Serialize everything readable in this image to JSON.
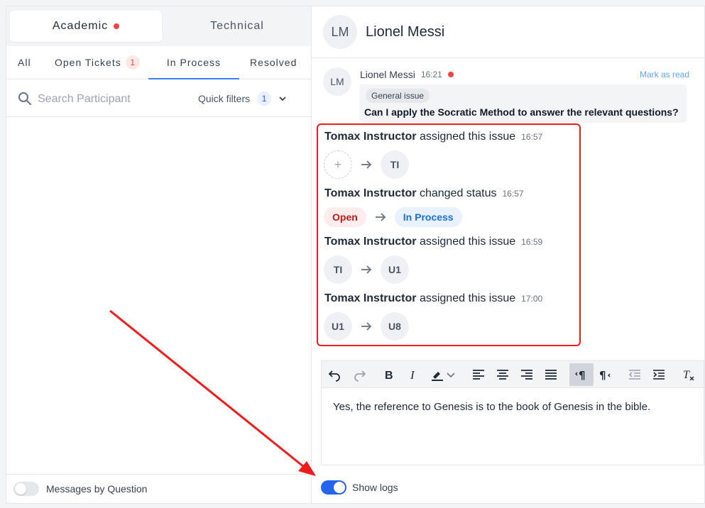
{
  "tabs": {
    "academic": "Academic",
    "technical": "Technical"
  },
  "subtabs": {
    "all": "All",
    "open_tickets": "Open Tickets",
    "open_tickets_count": "1",
    "in_process": "In Process",
    "resolved": "Resolved"
  },
  "search": {
    "placeholder": "Search Participant",
    "quick_filters": "Quick filters",
    "quick_filters_count": "1"
  },
  "left_footer": {
    "label": "Messages by Question",
    "toggle_on": false
  },
  "header": {
    "initials": "LM",
    "name": "Lionel Messi"
  },
  "message": {
    "initials": "LM",
    "sender": "Lionel Messi",
    "time": "16:21",
    "mark_read": "Mark as read",
    "tag": "General issue",
    "text": "Can I apply the Socratic Method to answer the relevant questions?"
  },
  "logs": [
    {
      "actor": "Tomax Instructor",
      "action": "assigned this issue",
      "time": "16:57",
      "from": "+",
      "to": "TI"
    },
    {
      "actor": "Tomax Instructor",
      "action": "changed status",
      "time": "16:57",
      "from": "Open",
      "to": "In Process"
    },
    {
      "actor": "Tomax Instructor",
      "action": "assigned this issue",
      "time": "16:59",
      "from": "TI",
      "to": "U1"
    },
    {
      "actor": "Tomax Instructor",
      "action": "assigned this issue",
      "time": "17:00",
      "from": "U1",
      "to": "U8"
    }
  ],
  "toolbar_icons": [
    "undo-icon",
    "redo-icon",
    "bold-icon",
    "italic-icon",
    "highlight-icon",
    "chevron-down-icon",
    "align-left-icon",
    "align-center-icon",
    "align-right-icon",
    "align-justify-icon",
    "ltr-icon",
    "rtl-icon",
    "outdent-icon",
    "indent-icon",
    "clear-format-icon"
  ],
  "editor": {
    "text": "Yes, the reference to Genesis is to the book of Genesis in the bible."
  },
  "right_footer": {
    "label": "Show logs",
    "toggle_on": true
  },
  "colors": {
    "accent": "#2563eb",
    "highlight_box": "#ef1c1c",
    "unread_dot": "#ef4444"
  }
}
